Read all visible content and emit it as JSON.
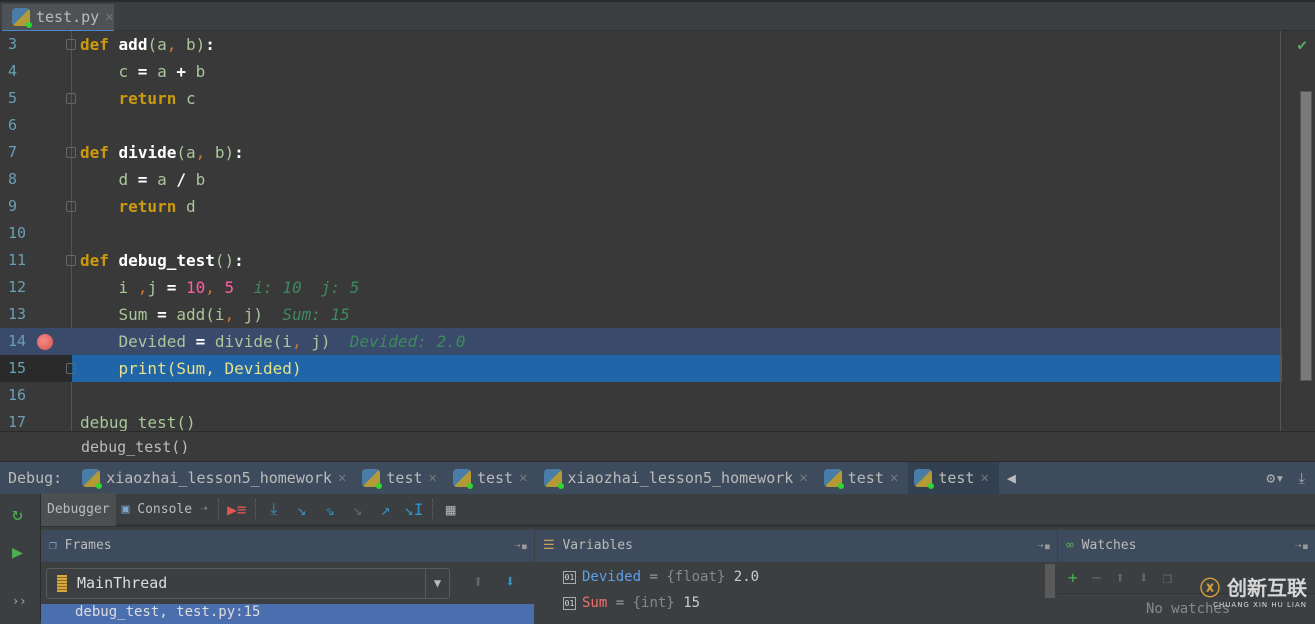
{
  "file_tab": {
    "label": "test.py"
  },
  "editor": {
    "lines": [
      {
        "n": "3",
        "tokens": [
          [
            "def",
            "kw"
          ],
          [
            " ",
            ""
          ],
          [
            "add",
            "fn"
          ],
          [
            "(",
            "pl"
          ],
          [
            "a",
            "id"
          ],
          [
            ",",
            "cm"
          ],
          [
            " b",
            "id"
          ],
          [
            ")",
            "pl"
          ],
          [
            ":",
            "op"
          ]
        ]
      },
      {
        "n": "4",
        "tokens": [
          [
            "    c ",
            "id"
          ],
          [
            "=",
            " op"
          ],
          [
            " a ",
            "id"
          ],
          [
            "+",
            "op"
          ],
          [
            " b",
            "id"
          ]
        ]
      },
      {
        "n": "5",
        "tokens": [
          [
            "    ",
            ""
          ],
          [
            "return",
            "kw"
          ],
          [
            " c",
            "id"
          ]
        ]
      },
      {
        "n": "6",
        "tokens": []
      },
      {
        "n": "7",
        "tokens": [
          [
            "def",
            "kw"
          ],
          [
            " ",
            ""
          ],
          [
            "divide",
            "fn"
          ],
          [
            "(",
            "pl"
          ],
          [
            "a",
            "id"
          ],
          [
            ",",
            "cm"
          ],
          [
            " b",
            "id"
          ],
          [
            ")",
            "pl"
          ],
          [
            ":",
            "op"
          ]
        ]
      },
      {
        "n": "8",
        "tokens": [
          [
            "    d ",
            "id"
          ],
          [
            "=",
            "op"
          ],
          [
            " a ",
            "id"
          ],
          [
            "/",
            "op"
          ],
          [
            " b",
            "id"
          ]
        ]
      },
      {
        "n": "9",
        "tokens": [
          [
            "    ",
            ""
          ],
          [
            "return",
            "kw"
          ],
          [
            " d",
            "id"
          ]
        ]
      },
      {
        "n": "10",
        "tokens": []
      },
      {
        "n": "11",
        "tokens": [
          [
            "def",
            "kw"
          ],
          [
            " ",
            ""
          ],
          [
            "debug_test",
            "fn"
          ],
          [
            "()",
            "pl"
          ],
          [
            ":",
            "op"
          ]
        ]
      },
      {
        "n": "12",
        "tokens": [
          [
            "    i ",
            "id"
          ],
          [
            ",",
            "cm"
          ],
          [
            "j ",
            "id"
          ],
          [
            "=",
            "op"
          ],
          [
            " ",
            ""
          ],
          [
            "10",
            "num"
          ],
          [
            ",",
            "cm"
          ],
          [
            " ",
            ""
          ],
          [
            "5",
            "num"
          ],
          [
            "  i: 10  j: 5",
            "hint"
          ]
        ]
      },
      {
        "n": "13",
        "tokens": [
          [
            "    Sum ",
            "id"
          ],
          [
            "=",
            "op"
          ],
          [
            " add(i",
            "id"
          ],
          [
            ",",
            "cm"
          ],
          [
            " j)",
            "id"
          ],
          [
            "  Sum: 15",
            "hint"
          ]
        ]
      },
      {
        "n": "14",
        "tokens": [
          [
            "    Devided ",
            "id"
          ],
          [
            "=",
            "op"
          ],
          [
            " divide(i",
            "id"
          ],
          [
            ",",
            "cm"
          ],
          [
            " j)",
            "id"
          ],
          [
            "  Devided: 2.0",
            "hint"
          ]
        ]
      },
      {
        "n": "15",
        "tokens": [
          [
            "    print",
            "pr"
          ],
          [
            "(",
            "pr"
          ],
          [
            "Sum, Devided",
            "pr"
          ],
          [
            ")",
            "pr"
          ]
        ]
      },
      {
        "n": "16",
        "tokens": []
      },
      {
        "n": "17",
        "tokens": [
          [
            "debug_test()",
            "id"
          ]
        ]
      }
    ],
    "breakpoint_line": "14",
    "current_line": "15"
  },
  "breadcrumb": "debug_test()",
  "debug": {
    "label": "Debug:",
    "tabs": [
      "xiaozhai_lesson5_homework",
      "test",
      "test",
      "xiaozhai_lesson5_homework",
      "test",
      "test"
    ],
    "active_tab": 5,
    "debugger_tab": "Debugger",
    "console_tab": "Console",
    "frames": {
      "title": "Frames",
      "thread": "MainThread",
      "frame": "debug_test, test.py:15"
    },
    "variables": {
      "title": "Variables",
      "items": [
        {
          "name": "Devided",
          "type": "{float}",
          "value": "2.0",
          "color": "#5c9fe8"
        },
        {
          "name": "Sum",
          "type": "{int}",
          "value": "15",
          "color": "#f07070"
        }
      ]
    },
    "watches": {
      "title": "Watches",
      "empty": "No watches"
    }
  },
  "watermark": {
    "text": "创新互联",
    "sub": "CHUANG XIN HU LIAN"
  }
}
